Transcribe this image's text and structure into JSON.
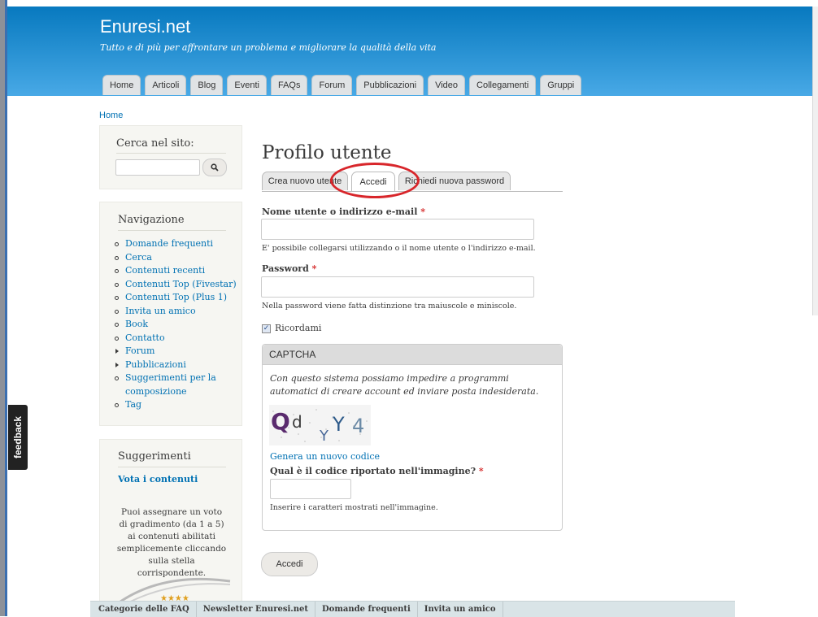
{
  "site": {
    "name": "Enuresi.net",
    "slogan": "Tutto e di più per affrontare un problema e migliorare la qualità della vita"
  },
  "main_menu": [
    "Home",
    "Articoli",
    "Blog",
    "Eventi",
    "FAQs",
    "Forum",
    "Pubblicazioni",
    "Video",
    "Collegamenti",
    "Gruppi"
  ],
  "breadcrumb": "Home",
  "search_block": {
    "title": "Cerca nel sito:",
    "value": ""
  },
  "navigation": {
    "title": "Navigazione",
    "items": [
      {
        "label": "Domande frequenti",
        "marker": "bullet"
      },
      {
        "label": "Cerca",
        "marker": "bullet"
      },
      {
        "label": "Contenuti recenti",
        "marker": "bullet"
      },
      {
        "label": "Contenuti Top (Fivestar)",
        "marker": "bullet"
      },
      {
        "label": "Contenuti Top (Plus 1)",
        "marker": "bullet"
      },
      {
        "label": "Invita un amico",
        "marker": "bullet"
      },
      {
        "label": "Book",
        "marker": "bullet"
      },
      {
        "label": "Contatto",
        "marker": "bullet"
      },
      {
        "label": "Forum",
        "marker": "arrow"
      },
      {
        "label": "Pubblicazioni",
        "marker": "arrow"
      },
      {
        "label": "Suggerimenti per la composizione",
        "marker": "bullet"
      },
      {
        "label": "Tag",
        "marker": "bullet"
      }
    ]
  },
  "suggestions": {
    "title": "Suggerimenti",
    "link": "Vota i contenuti",
    "text": "Puoi assegnare un voto di gradimento (da 1 a 5) ai contenuti abilitati semplicemente cliccando sulla stella corrispondente."
  },
  "feedback_tab": "feedback",
  "page": {
    "title": "Profilo utente",
    "tabs": [
      {
        "label": "Crea nuovo utente",
        "active": false
      },
      {
        "label": "Accedi",
        "active": true
      },
      {
        "label": "Richiedi nuova password",
        "active": false
      }
    ],
    "username": {
      "label": "Nome utente o indirizzo e-mail",
      "required": "*",
      "value": "",
      "description": "E' possibile collegarsi utilizzando o il nome utente o l'indirizzo e-mail."
    },
    "password": {
      "label": "Password",
      "required": "*",
      "value": "",
      "description": "Nella password viene fatta distinzione tra maiuscole e miniscole."
    },
    "remember": {
      "label": "Ricordami",
      "checked": true
    },
    "captcha": {
      "title": "CAPTCHA",
      "description": "Con questo sistema possiamo impedire a programmi automatici di creare account ed inviare posta indesiderata.",
      "image_text": "Qd Y 4",
      "regenerate": "Genera un nuovo codice",
      "code_label": "Qual è il codice riportato nell'immagine?",
      "code_required": "*",
      "code_value": "",
      "code_description": "Inserire i caratteri mostrati nell'immagine."
    },
    "submit": "Accedi"
  },
  "footer_links": [
    "Categorie delle FAQ",
    "Newsletter Enuresi.net",
    "Domande frequenti",
    "Invita un amico"
  ],
  "colors": {
    "header": "#0779bf",
    "link": "#0071b3",
    "annotation_circle": "#d8262b",
    "required": "#d52a2a"
  }
}
